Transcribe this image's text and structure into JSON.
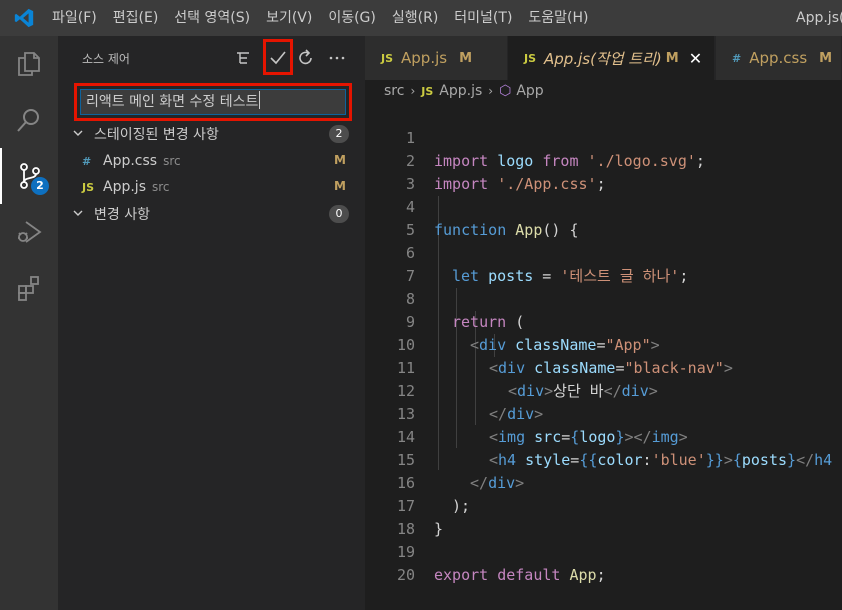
{
  "menu": [
    "파일(F)",
    "편집(E)",
    "선택 영역(S)",
    "보기(V)",
    "이동(G)",
    "실행(R)",
    "터미널(T)",
    "도움말(H)"
  ],
  "window_title": "App.js(작",
  "activity": {
    "scm_badge": "2"
  },
  "sidebar": {
    "title": "소스 제어",
    "commit_message": "리액트 메인 화면 수정 테스트",
    "staged": {
      "label": "스테이징된 변경 사항",
      "count": "2"
    },
    "staged_files": [
      {
        "icon": "#",
        "name": "App.css",
        "dir": "src",
        "status": "M"
      },
      {
        "icon": "JS",
        "name": "App.js",
        "dir": "src",
        "status": "M"
      }
    ],
    "changes": {
      "label": "변경 사항",
      "count": "0"
    }
  },
  "tabs": [
    {
      "icon": "JS",
      "label": "App.js",
      "modified": "M"
    },
    {
      "icon": "JS",
      "label": "App.js(작업 트리)",
      "modified": "M"
    },
    {
      "icon": "#",
      "label": "App.css",
      "modified": "M"
    }
  ],
  "breadcrumb": {
    "folder": "src",
    "file_icon": "JS",
    "file": "App.js",
    "symbol": "App"
  },
  "editor": {
    "line_numbers": [
      "1",
      "2",
      "3",
      "4",
      "5",
      "6",
      "7",
      "8",
      "9",
      "10",
      "11",
      "12",
      "13",
      "14",
      "15",
      "16",
      "17",
      "18",
      "19",
      "20"
    ],
    "tokens": {
      "l1": [
        "import",
        " logo ",
        "from",
        " './logo.svg'",
        ";"
      ],
      "l2": [
        "import",
        " './App.css'",
        ";"
      ],
      "l4": [
        "function",
        " ",
        "App",
        "() {"
      ],
      "l6": [
        "let",
        " ",
        "posts",
        " = ",
        "'테스트 글 하나'",
        ";"
      ],
      "l8": [
        "return",
        " ("
      ],
      "l9": [
        "<",
        "div",
        " ",
        "className",
        "=",
        "\"App\"",
        ">"
      ],
      "l10": [
        "<",
        "div",
        " ",
        "className",
        "=",
        "\"black-nav\"",
        ">"
      ],
      "l11": [
        "<",
        "div",
        ">",
        "상단 바",
        "</",
        "div",
        ">"
      ],
      "l12": [
        "</",
        "div",
        ">"
      ],
      "l13": [
        "<",
        "img",
        " ",
        "src",
        "=",
        "{",
        "logo",
        "}",
        "></",
        "img",
        ">"
      ],
      "l14": [
        "<",
        "h4",
        " ",
        "style",
        "=",
        "{{",
        "color",
        ":",
        "'blue'",
        "}}",
        ">",
        "{",
        "posts",
        "}",
        "</",
        "h4"
      ],
      "l15": [
        "</",
        "div",
        ">"
      ],
      "l16": [
        ");"
      ],
      "l17": [
        "}"
      ],
      "l19": [
        "export",
        " ",
        "default",
        " ",
        "App",
        ";"
      ]
    }
  }
}
